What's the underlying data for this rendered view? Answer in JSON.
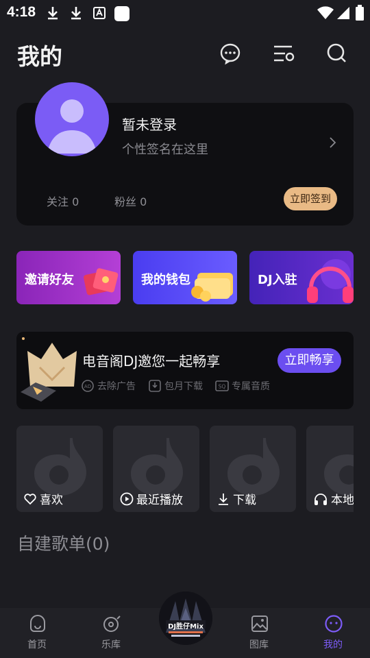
{
  "status_bar": {
    "time": "4:18"
  },
  "header": {
    "title": "我的",
    "icons": [
      "message-icon",
      "playlist-icon",
      "search-icon"
    ]
  },
  "profile": {
    "login_title": "暂未登录",
    "signature": "个性签名在这里",
    "follow_label": "关注 0",
    "fans_label": "粉丝 0",
    "checkin_label": "立即签到"
  },
  "features": [
    {
      "label": "邀请好友"
    },
    {
      "label": "我的钱包"
    },
    {
      "label": "DJ入驻"
    }
  ],
  "vip": {
    "title": "电音阁DJ邀您一起畅享",
    "button": "立即畅享",
    "benefits": [
      "去除广告",
      "包月下载",
      "专属音质"
    ]
  },
  "shortcuts": [
    {
      "label": "喜欢",
      "icon": "heart-icon"
    },
    {
      "label": "最近播放",
      "icon": "play-icon"
    },
    {
      "label": "下载",
      "icon": "download-icon"
    },
    {
      "label": "本地",
      "icon": "headphones-icon"
    }
  ],
  "playlist": {
    "title": "自建歌单(0)"
  },
  "nav": {
    "items": [
      {
        "label": "首页",
        "icon": "home-icon"
      },
      {
        "label": "乐库",
        "icon": "library-icon"
      },
      {
        "label": "图库",
        "icon": "gallery-icon"
      },
      {
        "label": "我的",
        "icon": "profile-icon"
      }
    ],
    "active": "我的",
    "center_disc_text": "DJ胜仔Mix"
  },
  "colors": {
    "background": "#1c1c21",
    "accent": "#7d5cf8",
    "checkin": "#e9ba85",
    "vip_button": "#6b4ef0"
  }
}
